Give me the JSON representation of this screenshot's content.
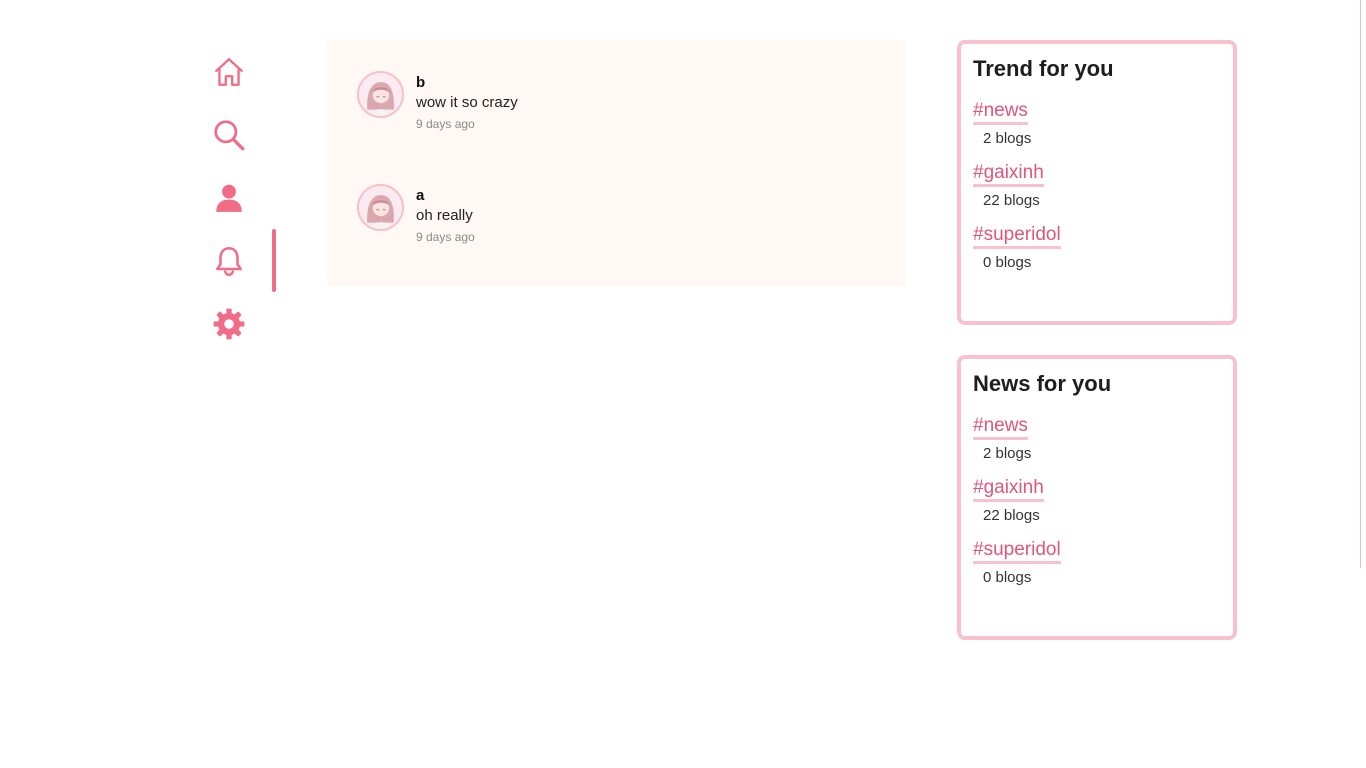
{
  "colors": {
    "accent": "#f06c87",
    "tag_text": "#e0567a",
    "panel_border": "#f9c1cd",
    "feed_bg": "#fff8f4"
  },
  "nav": {
    "items": [
      {
        "icon": "home-icon"
      },
      {
        "icon": "search-icon"
      },
      {
        "icon": "user-icon"
      },
      {
        "icon": "bell-icon",
        "active": true
      },
      {
        "icon": "gear-icon"
      }
    ]
  },
  "notifications": [
    {
      "user": "b",
      "message": "wow it so crazy",
      "time": "9 days ago"
    },
    {
      "user": "a",
      "message": "oh really",
      "time": "9 days ago"
    }
  ],
  "trend_panel": {
    "title": "Trend for you",
    "tags": [
      {
        "name": "#news",
        "count": "2 blogs"
      },
      {
        "name": "#gaixinh",
        "count": "22 blogs"
      },
      {
        "name": "#superidol",
        "count": "0 blogs"
      }
    ]
  },
  "news_panel": {
    "title": "News for you",
    "tags": [
      {
        "name": "#news",
        "count": "2 blogs"
      },
      {
        "name": "#gaixinh",
        "count": "22 blogs"
      },
      {
        "name": "#superidol",
        "count": "0 blogs"
      }
    ]
  }
}
